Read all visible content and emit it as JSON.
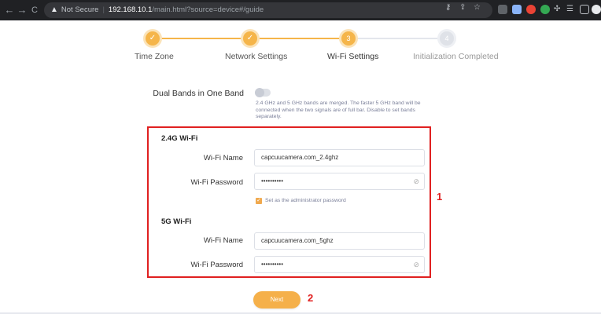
{
  "browser": {
    "back": "←",
    "forward": "→",
    "reload": "C",
    "warning_icon": "▲",
    "not_secure": "Not Secure",
    "host": "192.168.10.1",
    "path": "/main.html?source=device#/guide"
  },
  "steps": [
    {
      "label": "Time Zone",
      "state": "done",
      "mark": "✓"
    },
    {
      "label": "Network Settings",
      "state": "done",
      "mark": "✓"
    },
    {
      "label": "Wi-Fi Settings",
      "state": "current",
      "mark": "3"
    },
    {
      "label": "Initialization Completed",
      "state": "todo",
      "mark": "4"
    }
  ],
  "dual_band": {
    "label": "Dual Bands in One Band",
    "enabled": false,
    "description": "2.4 GHz and 5 GHz bands are merged. The faster 5 GHz band will be connected when the two signals are of full bar. Disable to set bands separately."
  },
  "wifi_24": {
    "title": "2.4G Wi-Fi",
    "name_label": "Wi-Fi Name",
    "name_value": "capcuucamera.com_2.4ghz",
    "password_label": "Wi-Fi Password",
    "password_value": "••••••••••",
    "admin_checkbox_label": "Set as the administrator password",
    "admin_checked": true
  },
  "wifi_5": {
    "title": "5G Wi-Fi",
    "name_label": "Wi-Fi Name",
    "name_value": "capcuucamera.com_5ghz",
    "password_label": "Wi-Fi Password",
    "password_value": "••••••••••"
  },
  "annotations": {
    "box": "1",
    "button": "2"
  },
  "next_button": "Next",
  "colors": {
    "accent": "#f5b04a",
    "annotation": "#e02020",
    "current_step_text": "#333333",
    "inactive_step_text": "#999999"
  }
}
